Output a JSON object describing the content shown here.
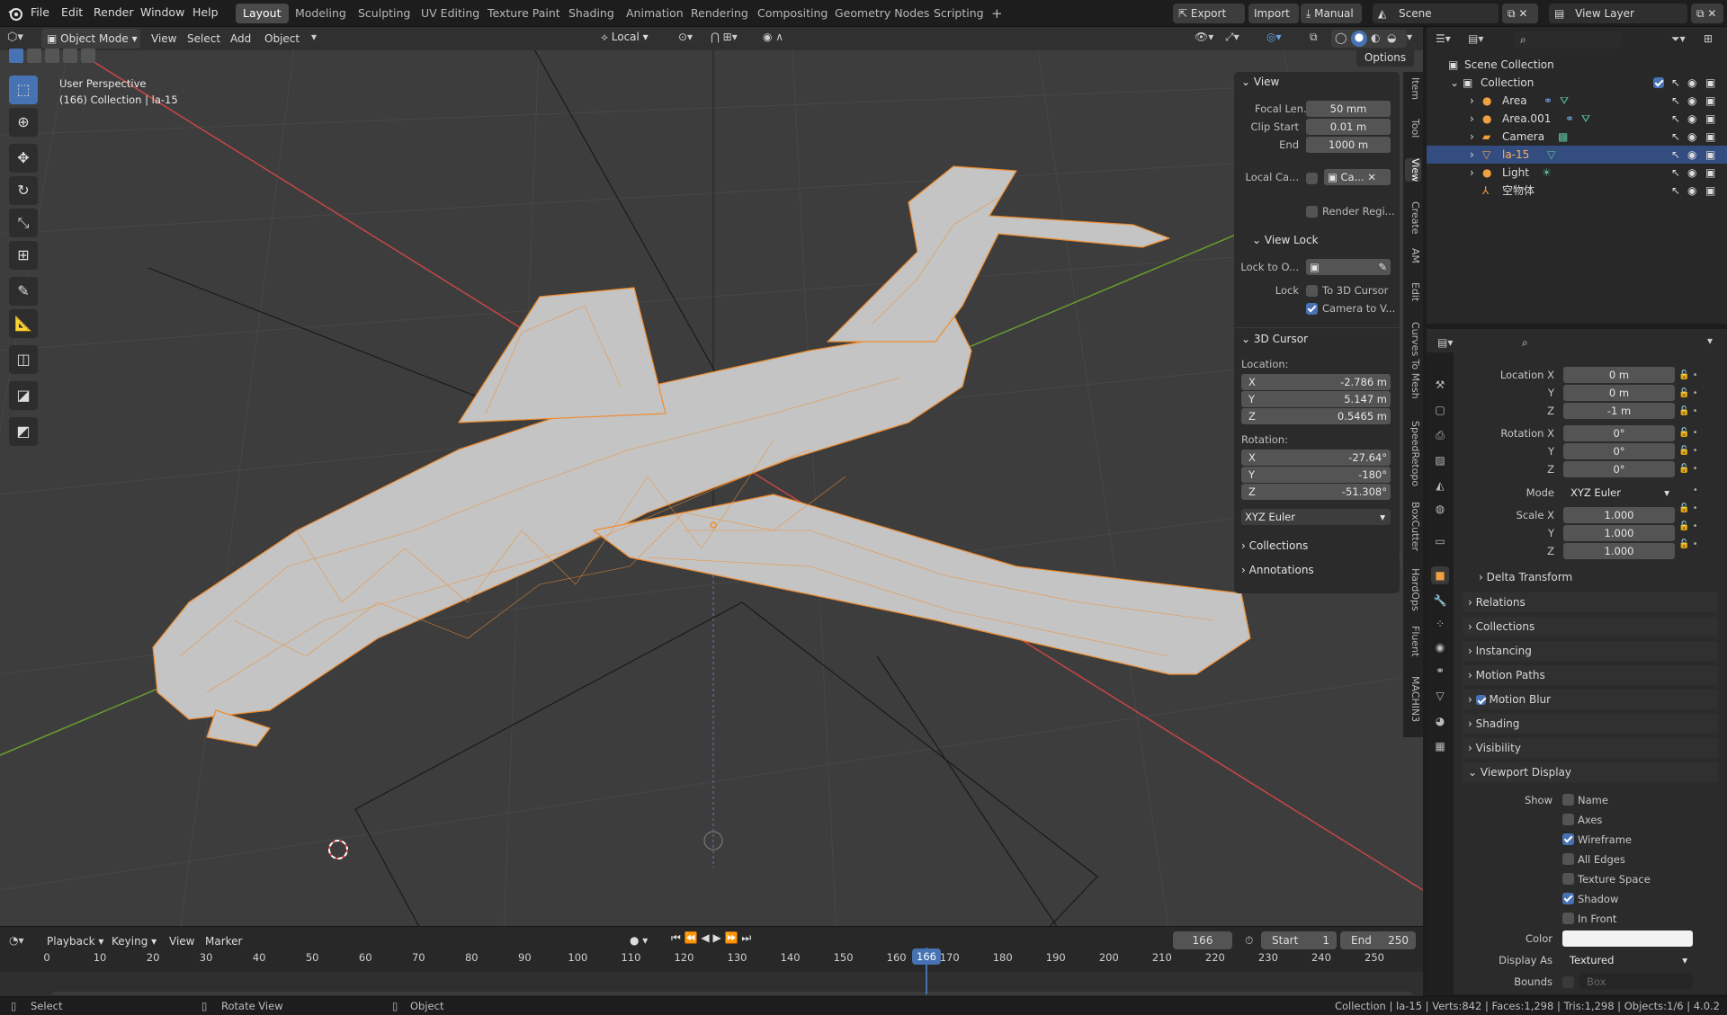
{
  "app": {
    "menu": [
      "File",
      "Edit",
      "Render",
      "Window",
      "Help"
    ],
    "workspaces": [
      "Layout",
      "Modeling",
      "Sculpting",
      "UV Editing",
      "Texture Paint",
      "Shading",
      "Animation",
      "Rendering",
      "Compositing",
      "Geometry Nodes",
      "Scripting"
    ],
    "active_workspace": "Layout",
    "add_workspace": "+",
    "export_label": "Export",
    "import_label": "Import",
    "manual_label": "Manual",
    "scene_name": "Scene",
    "view_layer": "View Layer"
  },
  "viewport_header": {
    "mode": "Object Mode",
    "menus": [
      "View",
      "Select",
      "Add",
      "Object"
    ],
    "orientation": "Local",
    "options_label": "Options"
  },
  "viewport": {
    "perspective_label": "User Perspective",
    "collection_label": "(166) Collection | la-15",
    "accent_color": "#f08c2e",
    "axis_x_color": "#c84646",
    "axis_y_color": "#6a9c2e"
  },
  "npanel": {
    "view_header": "View",
    "focal_length_label": "Focal Len...",
    "focal_length": "50 mm",
    "clip_start_label": "Clip Start",
    "clip_start": "0.01 m",
    "clip_end_label": "End",
    "clip_end": "1000 m",
    "local_camera_label": "Local Ca...",
    "local_camera_value": "Ca...",
    "render_region_label": "Render Regi...",
    "view_lock_header": "View Lock",
    "lock_to_object_label": "Lock to O...",
    "lock_label": "Lock",
    "to_3d_cursor_label": "To 3D Cursor",
    "camera_to_view_label": "Camera to V...",
    "camera_to_view_checked": true,
    "cursor_header": "3D Cursor",
    "location_label": "Location:",
    "loc_x": "-2.786 m",
    "loc_y": "5.147 m",
    "loc_z": "0.5465 m",
    "rotation_label": "Rotation:",
    "rot_x": "-27.64°",
    "rot_y": "-180°",
    "rot_z": "-51.308°",
    "axis_x": "X",
    "axis_y": "Y",
    "axis_z": "Z",
    "rotation_mode": "XYZ Euler",
    "collections_header": "Collections",
    "annotations_header": "Annotations",
    "side_tabs": [
      "Item",
      "Tool",
      "View",
      "Create",
      "AM",
      "Edit",
      "Curves To Mesh",
      "SpeedRetopo",
      "BoxCutter",
      "HardOps",
      "Fluent",
      "MACHIN3"
    ],
    "active_side_tab": "View"
  },
  "outliner": {
    "root": "Scene Collection",
    "collection": "Collection",
    "items": [
      {
        "name": "Area"
      },
      {
        "name": "Area.001"
      },
      {
        "name": "Camera"
      },
      {
        "name": "la-15",
        "selected": true
      },
      {
        "name": "Light"
      },
      {
        "name": "空物体"
      }
    ]
  },
  "properties": {
    "location_x_label": "Location X",
    "location_x": "0 m",
    "location_y": "0 m",
    "location_z": "-1 m",
    "rotation_x_label": "Rotation X",
    "rotation_x": "0°",
    "rotation_y": "0°",
    "rotation_z": "0°",
    "y_label": "Y",
    "z_label": "Z",
    "mode_label": "Mode",
    "mode_value": "XYZ Euler",
    "scale_x_label": "Scale X",
    "scale_x": "1.000",
    "scale_y": "1.000",
    "scale_z": "1.000",
    "delta_transform": "Delta Transform",
    "panels": [
      "Relations",
      "Collections",
      "Instancing",
      "Motion Paths",
      "Motion Blur",
      "Shading",
      "Visibility"
    ],
    "viewport_display": "Viewport Display",
    "show_label": "Show",
    "show_items": [
      {
        "label": "Name",
        "checked": false
      },
      {
        "label": "Axes",
        "checked": false
      },
      {
        "label": "Wireframe",
        "checked": true
      },
      {
        "label": "All Edges",
        "checked": false
      },
      {
        "label": "Texture Space",
        "checked": false
      },
      {
        "label": "Shadow",
        "checked": true
      },
      {
        "label": "In Front",
        "checked": false
      }
    ],
    "color_label": "Color",
    "color_value": "#f2f2f2",
    "display_as_label": "Display As",
    "display_as_value": "Textured",
    "bounds_label": "Bounds",
    "bounds_value": "Box"
  },
  "timeline": {
    "menus": [
      "Playback",
      "Keying",
      "View",
      "Marker"
    ],
    "current_frame": "166",
    "start_label": "Start",
    "start": "1",
    "end_label": "End",
    "end": "250",
    "ticks": [
      "0",
      "10",
      "20",
      "30",
      "40",
      "50",
      "60",
      "70",
      "80",
      "90",
      "100",
      "110",
      "120",
      "130",
      "140",
      "150",
      "160",
      "170",
      "180",
      "190",
      "200",
      "210",
      "220",
      "230",
      "240",
      "250"
    ],
    "playhead_label": "166"
  },
  "statusbar": {
    "select": "Select",
    "rotate_view": "Rotate View",
    "object": "Object",
    "stats": "Collection | la-15 | Verts:842 | Faces:1,298 | Tris:1,298 | Objects:1/6 | 4.0.2"
  }
}
